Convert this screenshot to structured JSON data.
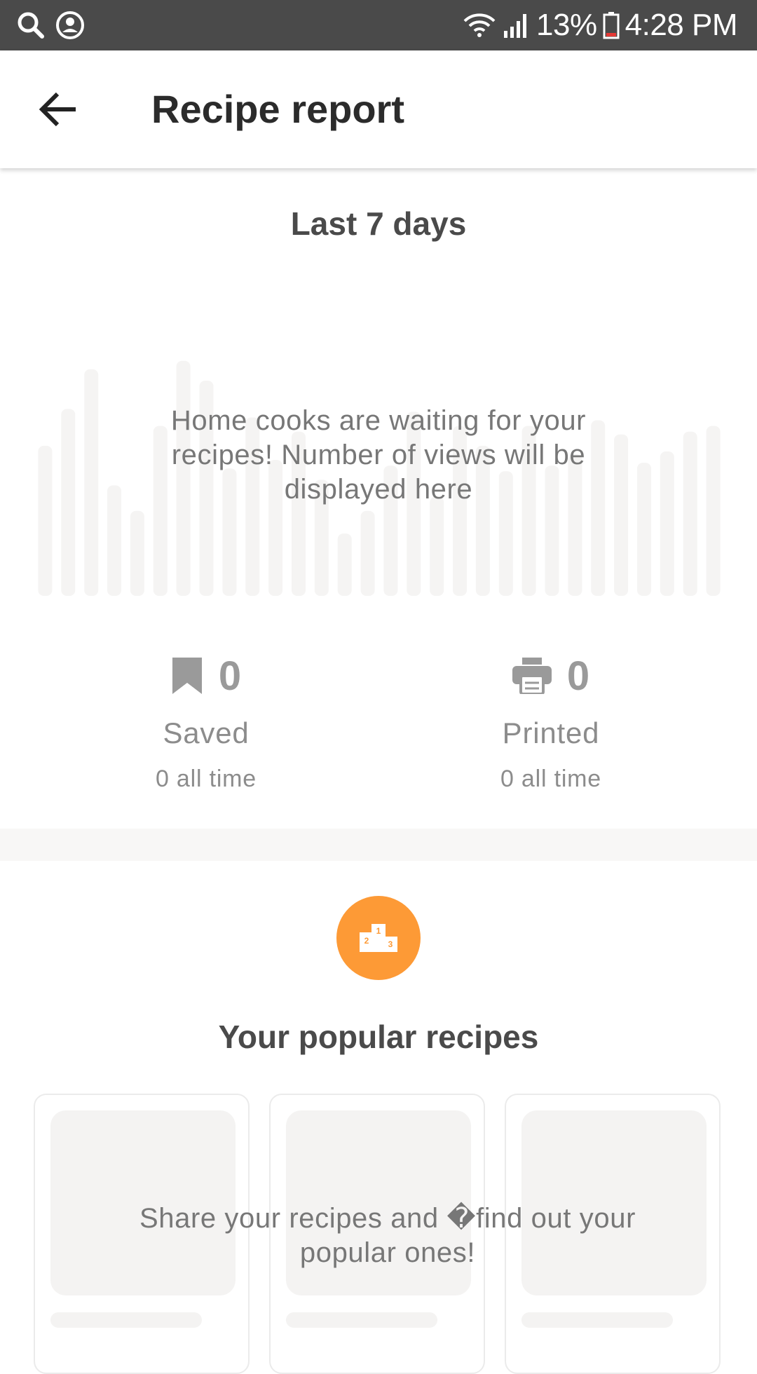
{
  "status_bar": {
    "left_icons": [
      "search-icon",
      "account-circle-icon"
    ],
    "right_icons": [
      "wifi-icon",
      "signal-icon",
      "battery-low-icon"
    ],
    "battery": "13%",
    "time": "4:28 PM"
  },
  "app_bar": {
    "back_icon": "arrow-left-icon",
    "title": "Recipe report"
  },
  "views": {
    "period": "Last 7 days",
    "empty_message": "Home cooks are waiting for your recipes! Number of views will be displayed here",
    "placeholder_bar_color": "#f5f4f3",
    "placeholder_bar_levels": [
      0.53,
      0.66,
      0.8,
      0.39,
      0.3,
      0.6,
      0.83,
      0.76,
      0.45,
      0.63,
      0.48,
      0.58,
      0.41,
      0.22,
      0.3,
      0.46,
      0.65,
      0.35,
      0.6,
      0.53,
      0.44,
      0.6,
      0.46,
      0.5,
      0.62,
      0.57,
      0.47,
      0.51,
      0.58,
      0.6
    ]
  },
  "stats": [
    {
      "icon": "bookmark-icon",
      "count": "0",
      "label": "Saved",
      "total": "0 all time"
    },
    {
      "icon": "printer-icon",
      "count": "0",
      "label": "Printed",
      "total": "0 all time"
    }
  ],
  "popular": {
    "badge_icon": "podium-icon",
    "badge_color": "#fd9a36",
    "podium_places": [
      "1",
      "2",
      "3"
    ],
    "title": "Your popular recipes",
    "empty_message": "Share your recipes and �find out your popular ones!"
  }
}
